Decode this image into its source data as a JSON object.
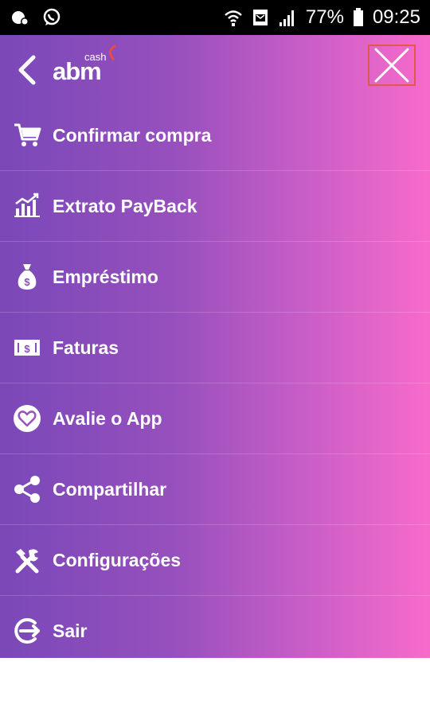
{
  "status_bar": {
    "battery": "77%",
    "time": "09:25",
    "icons": [
      "bug-icon",
      "whatsapp-icon",
      "wifi-icon",
      "sim-icon",
      "signal-icon",
      "battery-icon"
    ]
  },
  "header": {
    "logo_text": "abm",
    "logo_sub": "cash",
    "icons": [
      "back-arrow-icon",
      "close-icon"
    ]
  },
  "menu": {
    "items": [
      {
        "label": "Confirmar compra",
        "icon": "cart-icon"
      },
      {
        "label": "Extrato PayBack",
        "icon": "chart-icon"
      },
      {
        "label": "Empréstimo",
        "icon": "money-bag-icon"
      },
      {
        "label": "Faturas",
        "icon": "invoice-icon"
      },
      {
        "label": "Avalie o App",
        "icon": "heart-icon"
      },
      {
        "label": "Compartilhar",
        "icon": "share-icon"
      },
      {
        "label": "Configurações",
        "icon": "tools-icon"
      },
      {
        "label": "Sair",
        "icon": "logout-icon"
      }
    ]
  },
  "colors": {
    "gradient_left": "#7a48b8",
    "gradient_right": "#f76bca",
    "close_border": "#e05a4a"
  }
}
